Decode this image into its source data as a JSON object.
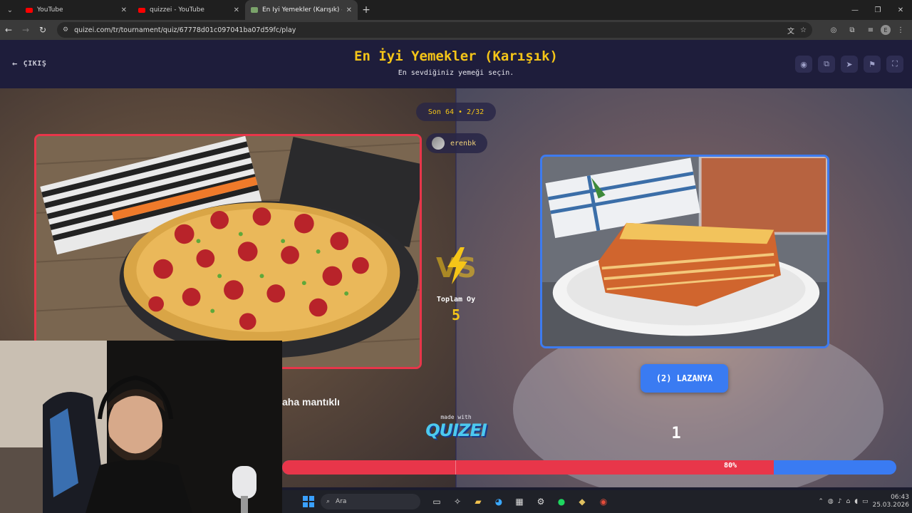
{
  "browser": {
    "tabs": [
      {
        "label": "YouTube"
      },
      {
        "label": "quizzei - YouTube"
      },
      {
        "label": "En İyi Yemekler (Karışık) - Tier L"
      }
    ],
    "url": "quizei.com/tr/tournament/quiz/67778d01c097041ba07d59fc/play",
    "profile_initial": "E"
  },
  "header": {
    "exit_label": "ÇIKIŞ",
    "title": "En İyi Yemekler (Karışık)",
    "subtitle": "En sevdiğiniz yemeği seçin."
  },
  "match": {
    "round": "Son 64 • 2/32",
    "creator": "erenbk",
    "total_votes_label": "Toplam Oy",
    "total_votes": "5",
    "right_choice_label": "(2) LAZANYA",
    "right_votes": "1",
    "left_percent_value": 80,
    "left_percent_label": "80%",
    "comment_fragment": "aha mantıklı"
  },
  "branding": {
    "made_with": "made with",
    "logo": "QUIZEI"
  },
  "taskbar": {
    "search_placeholder": "Ara",
    "time": "06:43",
    "date": "25.03.2026"
  },
  "colors": {
    "left_accent": "#e8364a",
    "right_accent": "#3a7bf2",
    "title_color": "#f5c518",
    "header_bg": "#1e1d3b"
  }
}
